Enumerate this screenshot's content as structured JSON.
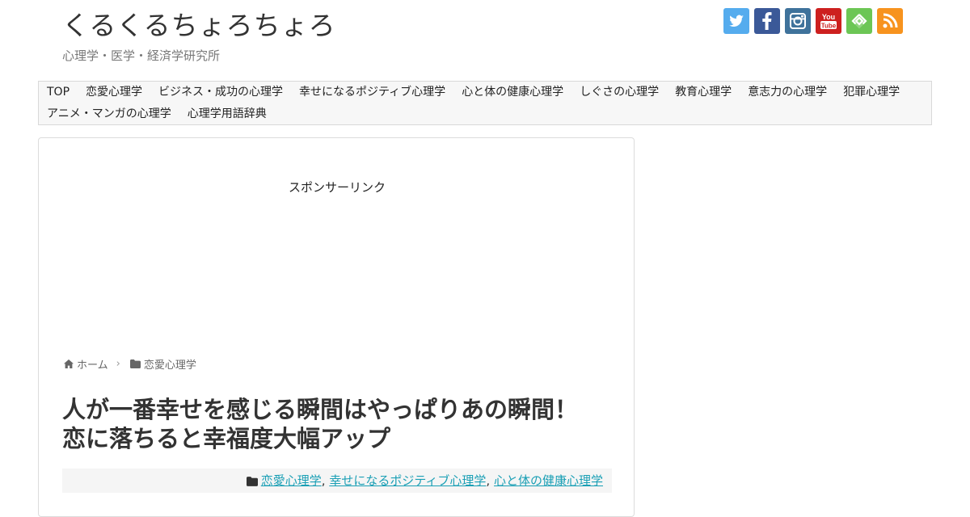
{
  "header": {
    "title": "くるくるちょろちょろ",
    "description": "心理学・医学・経済学研究所"
  },
  "social": [
    {
      "name": "twitter",
      "color": "#55acee"
    },
    {
      "name": "facebook",
      "color": "#3b5998"
    },
    {
      "name": "instagram",
      "color": "#3f729b"
    },
    {
      "name": "youtube",
      "color": "#cd201f"
    },
    {
      "name": "feedly",
      "color": "#6cc655"
    },
    {
      "name": "rss",
      "color": "#f7931e"
    }
  ],
  "nav": {
    "row1": [
      "TOP",
      "恋愛心理学",
      "ビジネス・成功の心理学",
      "幸せになるポジティブ心理学",
      "心と体の健康心理学",
      "しぐさの心理学",
      "教育心理学",
      "意志力の心理学",
      "犯罪心理学"
    ],
    "row2": [
      "アニメ・マンガの心理学",
      "心理学用語辞典"
    ]
  },
  "main": {
    "sponsor_label": "スポンサーリンク",
    "breadcrumb": {
      "home": "ホーム",
      "category": "恋愛心理学"
    },
    "title_line1": "人が一番幸せを感じる瞬間はやっぱりあの瞬間！",
    "title_line2": "恋に落ちると幸福度大幅アップ",
    "categories": [
      "恋愛心理学",
      "幸せになるポジティブ心理学",
      "心と体の健康心理学"
    ],
    "category_separator": ","
  },
  "colors": {
    "link": "#1a9fb5",
    "nav_bg": "#f7f7f7"
  }
}
